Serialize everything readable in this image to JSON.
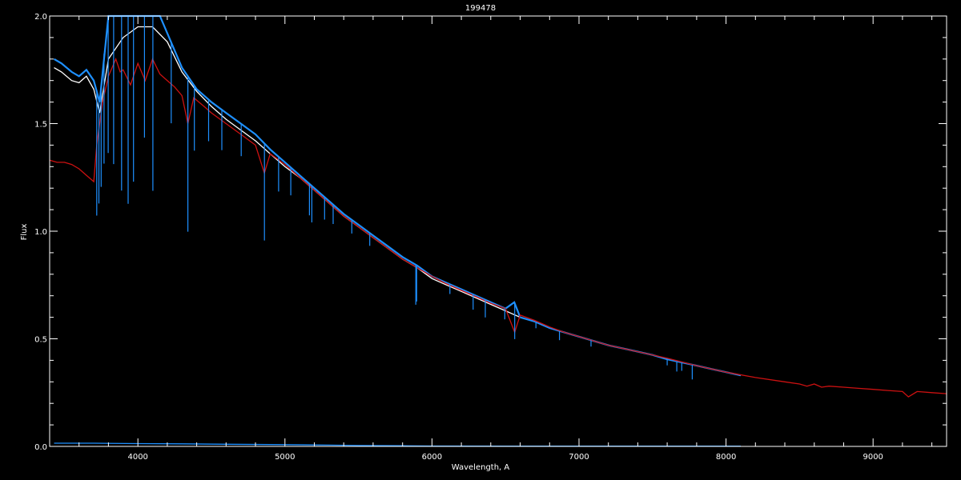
{
  "chart_data": {
    "type": "line",
    "title": "199478",
    "xlabel": "Wavelength, A",
    "ylabel": "Flux",
    "xlim": [
      3400,
      9500
    ],
    "ylim": [
      0.0,
      2.0
    ],
    "x_ticks": [
      4000,
      5000,
      6000,
      7000,
      8000,
      9000
    ],
    "y_ticks": [
      0.0,
      0.5,
      1.0,
      1.5,
      2.0
    ],
    "y_tick_labels": [
      "0.0",
      "0.5",
      "1.0",
      "1.5",
      "2.0"
    ],
    "grid": false,
    "colors": {
      "background": "#000000",
      "axes": "#ffffff",
      "observed_white": "#ffffff",
      "observed_blue": "#1e90ff",
      "model_red": "#cc1111",
      "error_blue": "#1e90ff"
    },
    "series": [
      {
        "role": "observed",
        "color": "#1e90ff",
        "x": [
          3430,
          3480,
          3550,
          3600,
          3650,
          3700,
          3740,
          3800,
          3850,
          3900,
          3950,
          4000,
          4050,
          4100,
          4150,
          4200,
          4300,
          4400,
          4500,
          4600,
          4700,
          4800,
          4900,
          5000,
          5100,
          5200,
          5300,
          5400,
          5500,
          5600,
          5700,
          5800,
          5900,
          6000,
          6100,
          6200,
          6300,
          6400,
          6500,
          6560,
          6600,
          6700,
          6800,
          6900,
          7000,
          7100,
          7200,
          7300,
          7400,
          7500,
          7600,
          7700,
          7800,
          7900,
          8000,
          8100
        ],
        "y": [
          1.8,
          1.78,
          1.74,
          1.72,
          1.75,
          1.7,
          1.6,
          2.05,
          2.05,
          2.05,
          2.05,
          2.05,
          2.05,
          2.05,
          2.0,
          1.92,
          1.76,
          1.66,
          1.6,
          1.55,
          1.5,
          1.45,
          1.38,
          1.32,
          1.26,
          1.2,
          1.14,
          1.08,
          1.03,
          0.98,
          0.93,
          0.88,
          0.84,
          0.79,
          0.76,
          0.73,
          0.7,
          0.67,
          0.64,
          0.67,
          0.6,
          0.58,
          0.55,
          0.53,
          0.51,
          0.49,
          0.47,
          0.455,
          0.44,
          0.425,
          0.405,
          0.39,
          0.375,
          0.36,
          0.345,
          0.33
        ]
      },
      {
        "role": "observed-white",
        "color": "#ffffff",
        "x": [
          3430,
          3480,
          3550,
          3600,
          3650,
          3700,
          3740,
          3800,
          3900,
          4000,
          4100,
          4200,
          4300,
          4400,
          4500,
          4600,
          4700,
          4800,
          4900,
          5000,
          5100,
          5200,
          5300,
          5400,
          5500,
          5600,
          5700,
          5800,
          5900,
          6000,
          6100,
          6200,
          6300,
          6400,
          6500,
          6600,
          6700,
          6800,
          6900,
          7000,
          7100,
          7200,
          7300,
          7400,
          7500,
          7600,
          7700,
          7800,
          7900,
          8000,
          8100
        ],
        "y": [
          1.76,
          1.74,
          1.7,
          1.69,
          1.72,
          1.66,
          1.55,
          1.8,
          1.9,
          1.95,
          1.95,
          1.88,
          1.74,
          1.65,
          1.58,
          1.52,
          1.47,
          1.42,
          1.36,
          1.3,
          1.25,
          1.19,
          1.13,
          1.07,
          1.02,
          0.97,
          0.92,
          0.87,
          0.83,
          0.78,
          0.75,
          0.72,
          0.69,
          0.66,
          0.63,
          0.6,
          0.58,
          0.55,
          0.53,
          0.51,
          0.49,
          0.47,
          0.455,
          0.44,
          0.425,
          0.405,
          0.39,
          0.375,
          0.36,
          0.345,
          0.33
        ]
      },
      {
        "role": "model",
        "color": "#cc1111",
        "x": [
          3400,
          3450,
          3500,
          3550,
          3600,
          3650,
          3700,
          3720,
          3760,
          3800,
          3850,
          3880,
          3900,
          3950,
          4000,
          4050,
          4100,
          4150,
          4200,
          4250,
          4300,
          4340,
          4380,
          4450,
          4500,
          4600,
          4700,
          4800,
          4860,
          4900,
          5000,
          5100,
          5200,
          5300,
          5400,
          5500,
          5600,
          5700,
          5800,
          5900,
          6000,
          6100,
          6200,
          6300,
          6400,
          6500,
          6563,
          6600,
          6700,
          6800,
          6900,
          7000,
          7200,
          7400,
          7600,
          7800,
          8000,
          8200,
          8400,
          8500,
          8550,
          8600,
          8650,
          8700,
          8800,
          8900,
          9000,
          9100,
          9200,
          9240,
          9300,
          9400,
          9500
        ],
        "y": [
          1.33,
          1.32,
          1.32,
          1.31,
          1.29,
          1.26,
          1.23,
          1.4,
          1.6,
          1.72,
          1.8,
          1.74,
          1.75,
          1.68,
          1.78,
          1.7,
          1.8,
          1.73,
          1.7,
          1.67,
          1.63,
          1.5,
          1.62,
          1.58,
          1.55,
          1.5,
          1.45,
          1.4,
          1.27,
          1.36,
          1.31,
          1.25,
          1.19,
          1.13,
          1.07,
          1.02,
          0.97,
          0.92,
          0.87,
          0.83,
          0.79,
          0.755,
          0.725,
          0.695,
          0.665,
          0.64,
          0.53,
          0.61,
          0.585,
          0.555,
          0.53,
          0.51,
          0.47,
          0.44,
          0.41,
          0.375,
          0.345,
          0.32,
          0.3,
          0.29,
          0.28,
          0.29,
          0.275,
          0.28,
          0.275,
          0.27,
          0.265,
          0.26,
          0.255,
          0.23,
          0.255,
          0.25,
          0.245
        ]
      },
      {
        "role": "error",
        "color": "#1e90ff",
        "x": [
          3430,
          3700,
          4000,
          4300,
          4600,
          5000,
          5300,
          5500,
          5800,
          6000,
          7000,
          8000,
          8100
        ],
        "y": [
          0.015,
          0.015,
          0.013,
          0.012,
          0.01,
          0.008,
          0.006,
          0.004,
          0.003,
          0.002,
          0.001,
          0.001,
          0.001
        ]
      }
    ]
  }
}
